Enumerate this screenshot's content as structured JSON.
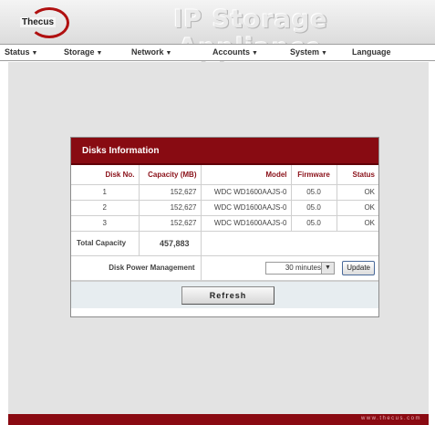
{
  "header": {
    "logo_text": "Thecus",
    "title": "IP Storage Appliance"
  },
  "menu": [
    {
      "label": "Status",
      "arrow": "▼"
    },
    {
      "label": "Storage",
      "arrow": "▼"
    },
    {
      "label": "Network",
      "arrow": "▼"
    },
    {
      "label": "Accounts",
      "arrow": "▼"
    },
    {
      "label": "System",
      "arrow": "▼"
    },
    {
      "label": "Language",
      "arrow": ""
    }
  ],
  "panel": {
    "title": "Disks Information",
    "columns": [
      "Disk No.",
      "Capacity (MB)",
      "Model",
      "Firmware",
      "Status"
    ],
    "rows": [
      {
        "disk_no": "1",
        "capacity": "152,627",
        "model": "WDC WD1600AAJS-0",
        "firmware": "05.0",
        "status": "OK"
      },
      {
        "disk_no": "2",
        "capacity": "152,627",
        "model": "WDC WD1600AAJS-0",
        "firmware": "05.0",
        "status": "OK"
      },
      {
        "disk_no": "3",
        "capacity": "152,627",
        "model": "WDC WD1600AAJS-0",
        "firmware": "05.0",
        "status": "OK"
      }
    ],
    "total_label": "Total Capacity",
    "total_value": "457,883",
    "power_label": "Disk Power Management",
    "power_value": "30 minutes",
    "update_label": "Update",
    "refresh_label": "Refresh"
  },
  "footer": {
    "url": "www.thecus.com"
  },
  "colors": {
    "accent": "#880b12",
    "content_bg": "#e3e3e3"
  }
}
